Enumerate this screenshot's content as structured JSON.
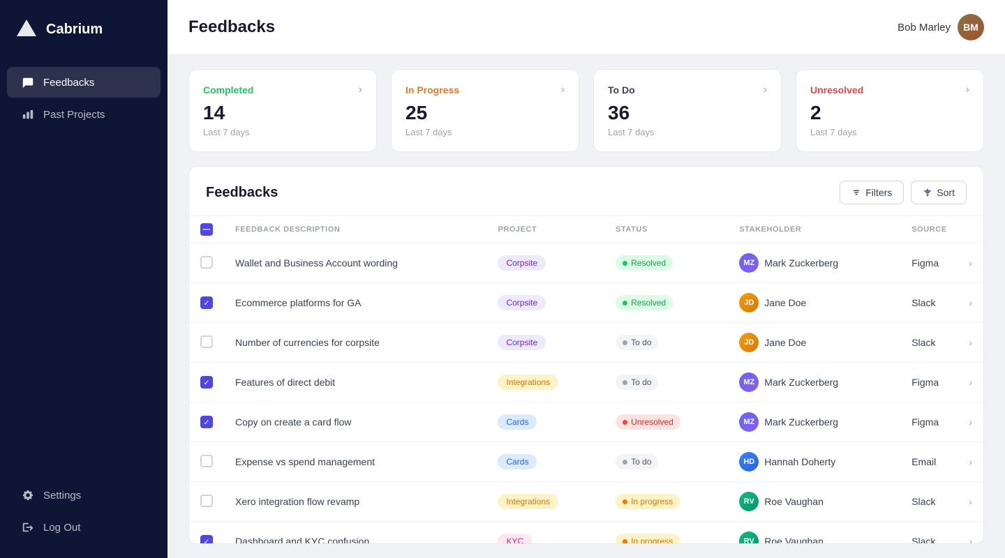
{
  "app": {
    "name": "Cabrium"
  },
  "sidebar": {
    "nav_items": [
      {
        "id": "feedbacks",
        "label": "Feedbacks",
        "active": true
      },
      {
        "id": "past-projects",
        "label": "Past Projects",
        "active": false
      }
    ],
    "bottom_items": [
      {
        "id": "settings",
        "label": "Settings"
      },
      {
        "id": "logout",
        "label": "Log Out"
      }
    ]
  },
  "header": {
    "title": "Feedbacks",
    "user_name": "Bob Marley"
  },
  "stats": [
    {
      "id": "completed",
      "label": "Completed",
      "type": "completed",
      "count": "14",
      "period": "Last 7 days"
    },
    {
      "id": "in-progress",
      "label": "In Progress",
      "type": "in-progress",
      "count": "25",
      "period": "Last 7 days"
    },
    {
      "id": "to-do",
      "label": "To Do",
      "type": "to-do",
      "count": "36",
      "period": "Last 7 days"
    },
    {
      "id": "unresolved",
      "label": "Unresolved",
      "type": "unresolved",
      "count": "2",
      "period": "Last 7 days"
    }
  ],
  "feedbacks_table": {
    "title": "Feedbacks",
    "filters_label": "Filters",
    "sort_label": "Sort",
    "columns": [
      "FEEDBACK DESCRIPTION",
      "PROJECT",
      "STATUS",
      "STAKEHOLDER",
      "SOURCE"
    ],
    "rows": [
      {
        "id": 1,
        "checked": false,
        "description": "Wallet and Business Account wording",
        "project": "Corpsite",
        "project_type": "corpsite",
        "status": "Resolved",
        "status_type": "resolved",
        "stakeholder": "Mark Zuckerberg",
        "stakeholder_avatar": "mz",
        "source": "Figma"
      },
      {
        "id": 2,
        "checked": true,
        "description": "Ecommerce platforms for GA",
        "project": "Corpsite",
        "project_type": "corpsite",
        "status": "Resolved",
        "status_type": "resolved",
        "stakeholder": "Jane Doe",
        "stakeholder_avatar": "jd",
        "source": "Slack"
      },
      {
        "id": 3,
        "checked": false,
        "description": "Number of currencies for corpsite",
        "project": "Corpsite",
        "project_type": "corpsite",
        "status": "To do",
        "status_type": "todo",
        "stakeholder": "Jane Doe",
        "stakeholder_avatar": "jd",
        "source": "Slack"
      },
      {
        "id": 4,
        "checked": true,
        "description": "Features of direct debit",
        "project": "Integrations",
        "project_type": "integrations",
        "status": "To do",
        "status_type": "todo",
        "stakeholder": "Mark Zuckerberg",
        "stakeholder_avatar": "mz",
        "source": "Figma"
      },
      {
        "id": 5,
        "checked": true,
        "description": "Copy on create a card flow",
        "project": "Cards",
        "project_type": "cards",
        "status": "Unresolved",
        "status_type": "unresolved",
        "stakeholder": "Mark Zuckerberg",
        "stakeholder_avatar": "mz",
        "source": "Figma"
      },
      {
        "id": 6,
        "checked": false,
        "description": "Expense vs spend management",
        "project": "Cards",
        "project_type": "cards",
        "status": "To do",
        "status_type": "todo",
        "stakeholder": "Hannah Doherty",
        "stakeholder_avatar": "hd",
        "source": "Email"
      },
      {
        "id": 7,
        "checked": false,
        "description": "Xero integration flow revamp",
        "project": "Integrations",
        "project_type": "integrations",
        "status": "In progress",
        "status_type": "inprogress",
        "stakeholder": "Roe Vaughan",
        "stakeholder_avatar": "rv",
        "source": "Slack"
      },
      {
        "id": 8,
        "checked": true,
        "description": "Dashboard and KYC confusion",
        "project": "KYC",
        "project_type": "kyc",
        "status": "In progress",
        "status_type": "inprogress",
        "stakeholder": "Roe Vaughan",
        "stakeholder_avatar": "rv",
        "source": "Slack"
      }
    ]
  }
}
